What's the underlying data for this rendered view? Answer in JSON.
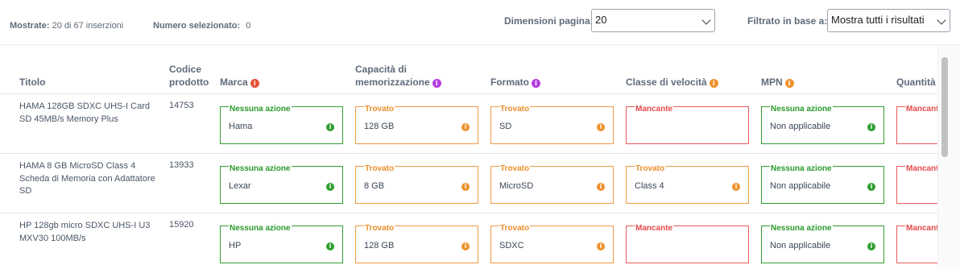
{
  "summary": {
    "shown_label": "Mostrate:",
    "shown_value": "20 di 67 inserzioni",
    "selected_label": "Numero selezionato:",
    "selected_value": "0"
  },
  "controls": {
    "page_size_label": "Dimensioni pagina:",
    "page_size_value": "20",
    "filter_label": "Filtrato in base a:",
    "filter_value": "Mostra tutti i risultati"
  },
  "columns": {
    "title": "Titolo",
    "code_line1": "Codice",
    "code_line2": "prodotto",
    "brand": "Marca",
    "capacity_line1": "Capacità di",
    "capacity_line2": "memorizzazione",
    "format": "Formato",
    "speed": "Classe di velocità",
    "mpn": "MPN",
    "quantity": "Quantità"
  },
  "colors": {
    "no_action": "#2f9e2f",
    "found": "#ee9a45",
    "missing": "#e85c5c",
    "info_purple": "#b63ee0"
  },
  "icons": {
    "info": "info-circle-icon",
    "dropdown": "chevron-down-icon"
  },
  "rows": [
    {
      "title": "HAMA 128GB SDXC UHS-I Card SD 45MB/s Memory Plus",
      "code": "14753",
      "brand": {
        "status": "Nessuna azione",
        "value": "Hama"
      },
      "capacity": {
        "status": "Trovato",
        "value": "128 GB"
      },
      "format": {
        "status": "Trovato",
        "value": "SD"
      },
      "speed": {
        "status": "Mancante",
        "value": ""
      },
      "mpn": {
        "status": "Nessuna azione",
        "value": "Non applicabile"
      },
      "quantity": {
        "status": "Mancante",
        "value": ""
      }
    },
    {
      "title": "HAMA 8 GB MicroSD Class 4 Scheda di Memoria con Adattatore SD",
      "code": "13933",
      "brand": {
        "status": "Nessuna azione",
        "value": "Lexar"
      },
      "capacity": {
        "status": "Trovato",
        "value": "8 GB"
      },
      "format": {
        "status": "Trovato",
        "value": "MicroSD"
      },
      "speed": {
        "status": "Trovato",
        "value": "Class 4"
      },
      "mpn": {
        "status": "Nessuna azione",
        "value": "Non applicabile"
      },
      "quantity": {
        "status": "Mancante",
        "value": ""
      }
    },
    {
      "title": "HP 128gb micro SDXC UHS-I U3 MXV30 100MB/s",
      "code": "15920",
      "brand": {
        "status": "Nessuna azione",
        "value": "HP"
      },
      "capacity": {
        "status": "Trovato",
        "value": "128 GB"
      },
      "format": {
        "status": "Trovato",
        "value": "SDXC"
      },
      "speed": {
        "status": "Mancante",
        "value": ""
      },
      "mpn": {
        "status": "Nessuna azione",
        "value": "Non applicabile"
      },
      "quantity": {
        "status": "Mancante",
        "value": ""
      }
    }
  ]
}
